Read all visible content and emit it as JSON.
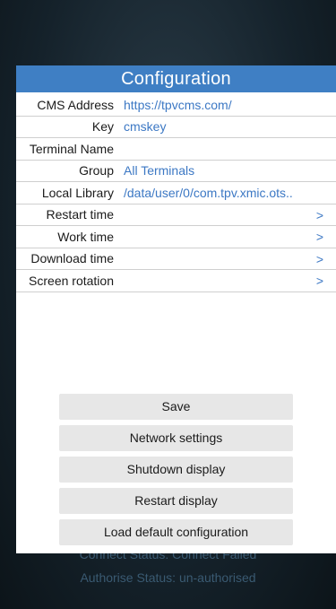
{
  "dialog": {
    "title": "Configuration",
    "rows": [
      {
        "label": "CMS Address",
        "value": "https://tpvcms.com/"
      },
      {
        "label": "Key",
        "value": "cmskey"
      },
      {
        "label": "Terminal Name",
        "value": ""
      },
      {
        "label": "Group",
        "value": "All Terminals"
      },
      {
        "label": "Local Library",
        "value": "/data/user/0/com.tpv.xmic.ots.."
      },
      {
        "label": "Restart time",
        "arrow": ">"
      },
      {
        "label": "Work time",
        "arrow": ">"
      },
      {
        "label": "Download time",
        "arrow": ">"
      },
      {
        "label": "Screen rotation",
        "arrow": ">"
      }
    ],
    "buttons": {
      "save": "Save",
      "network": "Network settings",
      "shutdown": "Shutdown display",
      "restart": "Restart display",
      "load_default": "Load default configuration"
    }
  },
  "background": {
    "connect_status": "Connect Status: Connect Failed",
    "authorise_status": "Authorise Status: un-authorised"
  },
  "colors": {
    "header": "#3f7fc4",
    "value_text": "#3c78c4",
    "button_bg": "#e7e7e7"
  }
}
